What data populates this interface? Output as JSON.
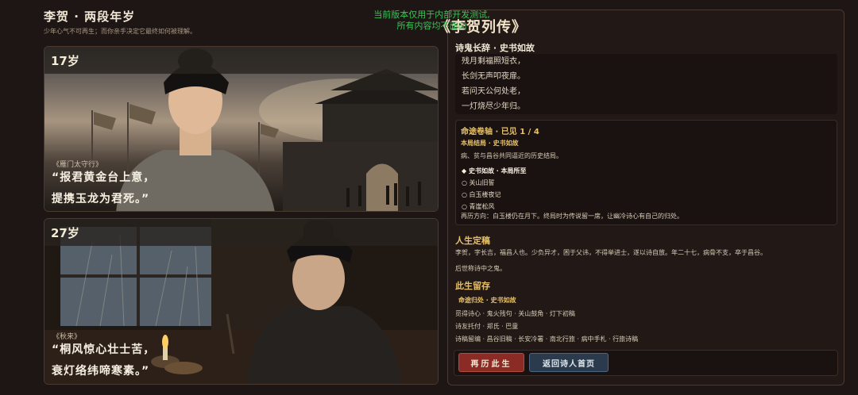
{
  "header": {
    "title": "李贺 · 两段年岁",
    "subtitle": "少年心气不可再生；而你亲手决定它最终如何被理解。"
  },
  "watermark": {
    "line1": "当前版本仅用于内部开发测试,",
    "line2": "所有内容均不面向"
  },
  "cards": [
    {
      "age": "17岁",
      "tag": "《雁门太守行》",
      "quote_line1": "“报君黄金台上意，",
      "quote_line2": "提携玉龙为君死。”"
    },
    {
      "age": "27岁",
      "tag": "《秋来》",
      "quote_line1": "“桐风惊心壮士苦，",
      "quote_line2": "衰灯络纬啼寒素。”"
    }
  ],
  "right_panel": {
    "title": "《李贺列传》",
    "poem_section": {
      "heading": "诗鬼长辞 · 史书如故",
      "lines": [
        "残月剩福照短衣，",
        "长剑无声叩夜扉。",
        "若问天公何处老，",
        "一灯烧尽少年归。"
      ]
    },
    "fate": {
      "heading": "命途卷轴 · 已见 1 / 4",
      "result_label": "本局结局 · 史书如故",
      "result_desc": "病、贫与昌谷共同逼近的历史结局。",
      "options": [
        {
          "marker": "◆",
          "label": "史书如故 · 本局所至",
          "selected": true
        },
        {
          "marker": "○",
          "label": "关山旧誓",
          "selected": false
        },
        {
          "marker": "○",
          "label": "白玉楼夜记",
          "selected": false
        },
        {
          "marker": "○",
          "label": "青崖松风",
          "selected": false
        }
      ],
      "next_hint": "再历方向：白玉楼仍在月下。终局时为传说留一席，让幽冷诗心有自己的归处。"
    },
    "life": {
      "heading": "人生定稿",
      "text_line1": "李贺，字长吉，福昌人也。少负异才，困于父讳，不得举进士，遂以诗自放。年二十七，病骨不支，卒于昌谷。",
      "text_line2": "后世称诗中之鬼。"
    },
    "keepsake": {
      "heading": "此生留存",
      "sub_heading": "命途归处 · 史书如故",
      "row1": "觅得诗心 · 鬼火残句 · 关山鼓角 · 灯下初稿",
      "row2": "诗友托付 · 郑氏 · 巴童",
      "row3": "诗稿留编 · 昌谷旧稿 · 长安冷署 · 南北行旅 · 病中手札 · 行旅诗稿"
    },
    "buttons": {
      "replay": "再历此生",
      "home": "返回诗人首页"
    }
  },
  "colors": {
    "accent_gold": "#e7c16a",
    "button_red": "#8a2b25",
    "button_blue": "#2b3a4c",
    "watermark_green": "#3fc25a"
  },
  "icons": [
    "more-dots-icon",
    "close-circle-icon"
  ]
}
